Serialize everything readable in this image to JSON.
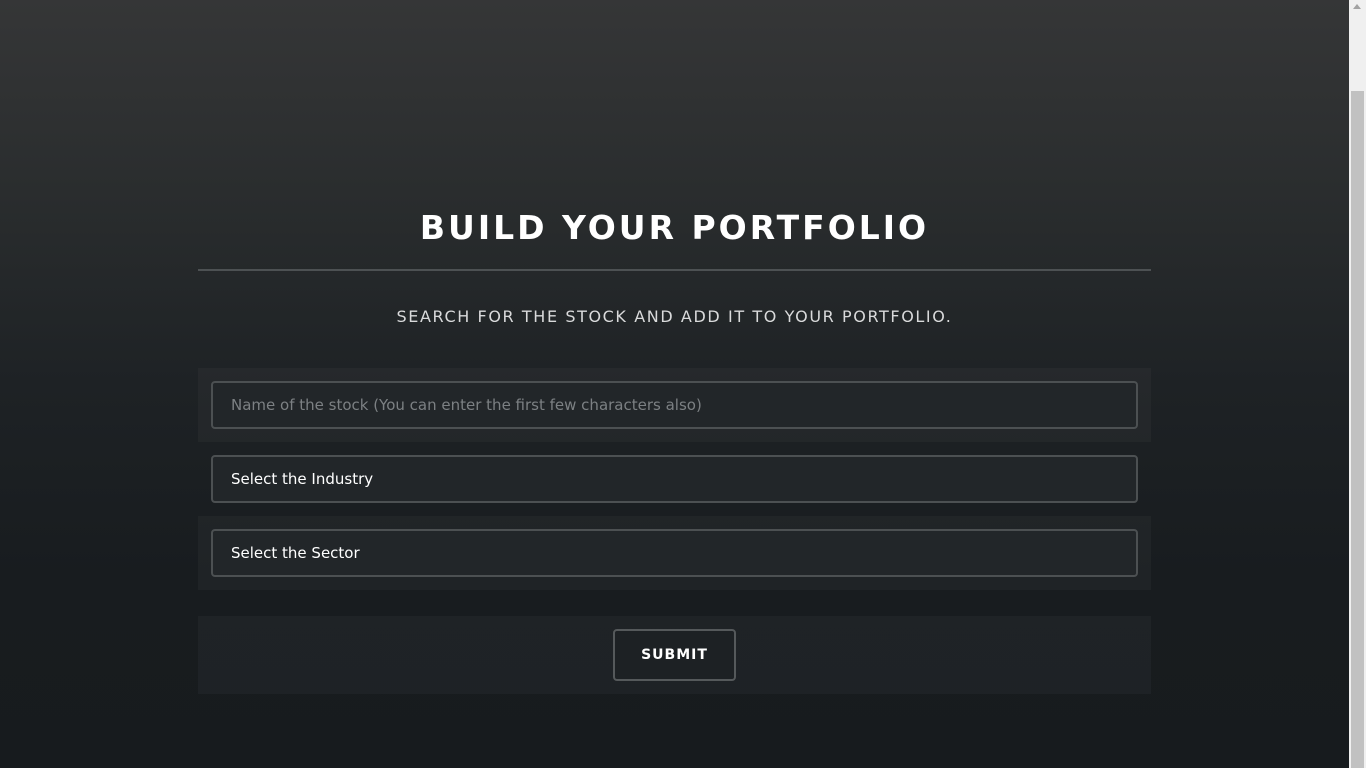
{
  "header": {
    "title": "BUILD YOUR PORTFOLIO",
    "subtitle": "SEARCH FOR THE STOCK AND ADD IT TO YOUR PORTFOLIO."
  },
  "form": {
    "stock_name_placeholder": "Name of the stock (You can enter the first few characters also)",
    "stock_name_value": "",
    "industry_select_value": "Select the Industry",
    "sector_select_value": "Select the Sector",
    "submit_label": "SUBMIT"
  },
  "colors": {
    "background_top": "#353637",
    "background_bottom": "#171b1e",
    "field_border": "#4c5052",
    "text": "#ffffff"
  }
}
